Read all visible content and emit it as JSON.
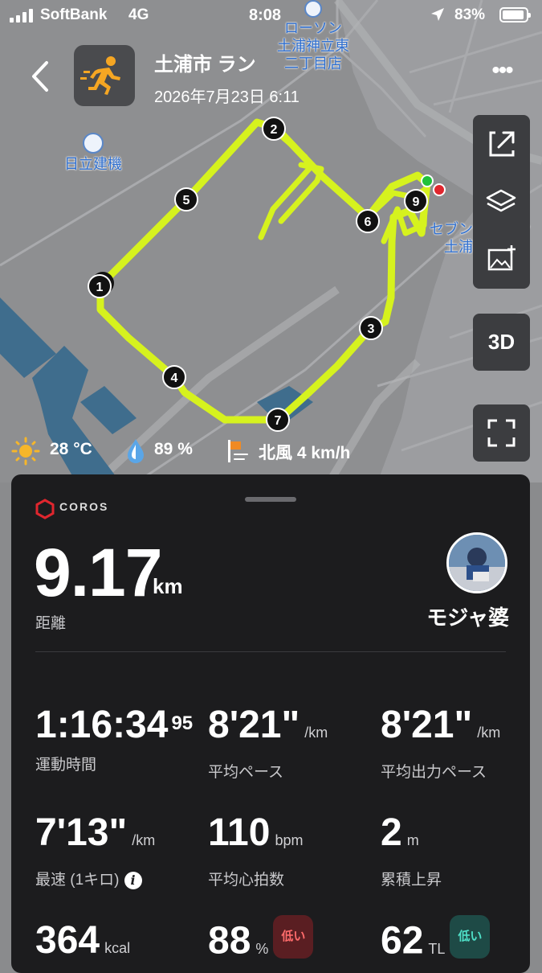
{
  "status": {
    "carrier": "SoftBank",
    "network": "4G",
    "time": "8:08",
    "battery": "83%"
  },
  "header": {
    "title": "土浦市 ラン",
    "date": "2026年7月23日 6:11"
  },
  "map": {
    "pois": [
      {
        "line1": "ローソン",
        "line2": "土浦神立東",
        "line3": "二丁目店"
      },
      {
        "line1": "日立建機"
      },
      {
        "line1": "セブンイレブン",
        "line2": "土浦白鳥店"
      }
    ],
    "laps": [
      "1",
      "2",
      "3",
      "4",
      "5",
      "6",
      "7",
      "8",
      "9"
    ],
    "route_color": "#d6f21e",
    "start_color": "#21c23a",
    "end_color": "#e0262e",
    "button_3d": "3D"
  },
  "weather": {
    "temp": "28 °C",
    "humidity": "89 %",
    "wind": "北風 4 km/h"
  },
  "card": {
    "brand": "COROS",
    "distance": "9.17",
    "distance_unit": "km",
    "distance_label": "距離",
    "username": "モジャ婆",
    "stats": [
      {
        "value": "1:16:34",
        "sup": "95",
        "unit": "",
        "label": "運動時間"
      },
      {
        "value": "8'21\"",
        "unit": "/km",
        "label": "平均ペース"
      },
      {
        "value": "8'21\"",
        "unit": "/km",
        "label": "平均出力ペース"
      },
      {
        "value": "7'13\"",
        "unit": "/km",
        "label": "最速 (1キロ)"
      },
      {
        "value": "110",
        "unit": "bpm",
        "label": "平均心拍数"
      },
      {
        "value": "2",
        "unit": "m",
        "label": "累積上昇"
      },
      {
        "value": "364",
        "unit": "kcal",
        "badge": ""
      },
      {
        "value": "88",
        "unit": "%",
        "badge": "低い"
      },
      {
        "value": "62",
        "unit": "TL",
        "badge": "低い"
      }
    ]
  }
}
